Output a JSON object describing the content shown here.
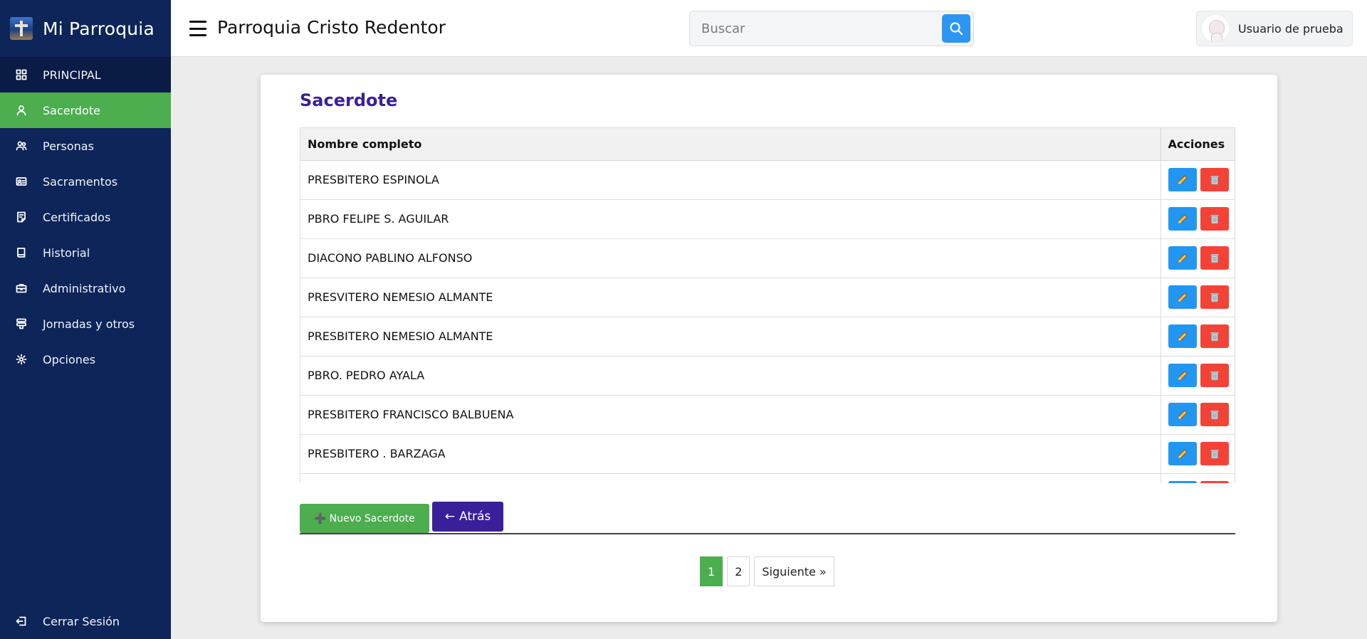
{
  "brand": {
    "title": "Mi Parroquia"
  },
  "sidebar": {
    "items": [
      {
        "label": "PRINCIPAL",
        "icon": "dashboard-icon"
      },
      {
        "label": "Sacerdote",
        "icon": "user-icon"
      },
      {
        "label": "Personas",
        "icon": "users-icon"
      },
      {
        "label": "Sacramentos",
        "icon": "id-card-icon"
      },
      {
        "label": "Certificados",
        "icon": "document-icon"
      },
      {
        "label": "Historial",
        "icon": "book-icon"
      },
      {
        "label": "Administrativo",
        "icon": "briefcase-icon"
      },
      {
        "label": "Jornadas y otros",
        "icon": "stack-icon"
      },
      {
        "label": "Opciones",
        "icon": "gear-icon"
      }
    ],
    "logout": {
      "label": "Cerrar Sesión",
      "icon": "logout-icon"
    }
  },
  "header": {
    "title": "Parroquia Cristo Redentor",
    "search_placeholder": "Buscar",
    "user_name": "Usuario de prueba"
  },
  "card": {
    "title": "Sacerdote",
    "columns": [
      "Nombre completo",
      "Acciones"
    ],
    "rows": [
      "PRESBITERO ESPINOLA",
      "PBRO FELIPE S. AGUILAR",
      "DIACONO PABLINO ALFONSO",
      "PRESVITERO NEMESIO ALMANTE",
      "PRESBITERO NEMESIO ALMANTE",
      "PBRO. PEDRO AYALA",
      "PRESBITERO FRANCISCO BALBUENA",
      "PRESBITERO . BARZAGA",
      ""
    ],
    "new_button": "Nuevo Sacerdote",
    "back_button": "Atrás"
  },
  "pagination": {
    "pages": [
      "1",
      "2"
    ],
    "current": "1",
    "next": "Siguiente »"
  },
  "colors": {
    "sidebar_bg": "#0d2558",
    "active_green": "#4cae4f",
    "title_purple": "#3a1f9a",
    "edit_blue": "#2196f3",
    "delete_red": "#f44336"
  }
}
